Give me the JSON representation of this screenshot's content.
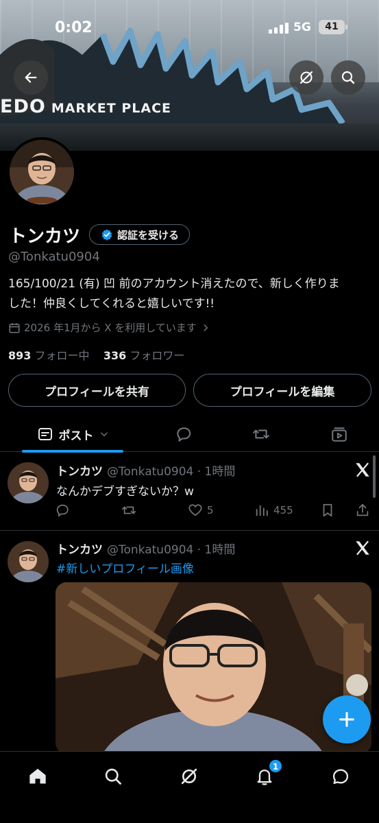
{
  "status_bar": {
    "time": "0:02",
    "network": "5G",
    "battery": "41"
  },
  "banner": {
    "sign_text": "EDO",
    "sign_sub": "MARKET PLACE"
  },
  "profile": {
    "name": "トンカツ",
    "verify_label": "認証を受ける",
    "handle": "@Tonkatu0904",
    "bio_line1": "165/100/21 (有) 凹 前のアカウント消えたので、新しく作りま",
    "bio_line2": "した！仲良くしてくれると嬉しいです!!",
    "joined": "2026 年1月から X を利用しています",
    "following_count": "893",
    "following_label": "フォロー中",
    "followers_count": "336",
    "followers_label": "フォロワー",
    "share_button": "プロフィールを共有",
    "edit_button": "プロフィールを編集"
  },
  "tabs": {
    "posts_label": "ポスト"
  },
  "posts": [
    {
      "name": "トンカツ",
      "meta": "@Tonkatu0904 · 1時間",
      "text": "なんかデブすぎないか？w",
      "likes": "5",
      "views": "455"
    },
    {
      "name": "トンカツ",
      "meta": "@Tonkatu0904 · 1時間",
      "text": "#新しいプロフィール画像"
    }
  ],
  "notifications_badge": "1",
  "colors": {
    "accent": "#1d9bf0",
    "muted": "#71767b",
    "border": "#2f3336",
    "background": "#000000"
  },
  "icons": [
    "back-arrow-icon",
    "grok-icon",
    "search-icon",
    "verified-check-icon",
    "calendar-icon",
    "chevron-right-icon",
    "post-icon",
    "chevron-down-icon",
    "reply-icon",
    "retweet-icon",
    "media-icon",
    "x-logo-icon",
    "heart-icon",
    "views-icon",
    "bookmark-icon",
    "share-icon",
    "plus-icon",
    "home-icon",
    "bell-icon",
    "messages-icon"
  ]
}
